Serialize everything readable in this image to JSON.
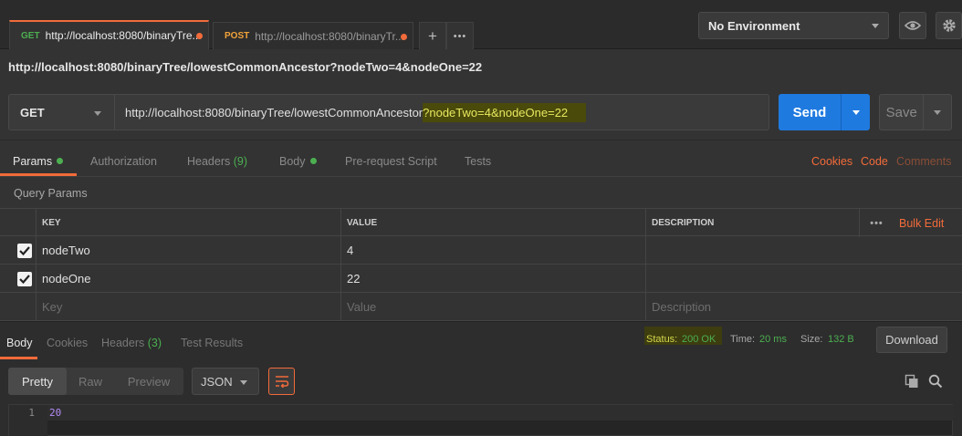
{
  "tabs": [
    {
      "method": "GET",
      "title": "http://localhost:8080/binaryTre...",
      "method_color": "#4caf50"
    },
    {
      "method": "POST",
      "title": "http://localhost:8080/binaryTr...",
      "method_color": "#f2a33a"
    }
  ],
  "tab_actions": {
    "add_icon": "plus-icon",
    "more_icon": "ellipsis-icon",
    "add_label": "+",
    "more_label": "•••"
  },
  "environment": {
    "selected": "No Environment"
  },
  "request": {
    "name": "http://localhost:8080/binaryTree/lowestCommonAncestor?nodeTwo=4&nodeOne=22",
    "method": "GET",
    "url_base": "http://localhost:8080/binaryTree/lowestCommonAncestor",
    "url_query": "?nodeTwo=4&nodeOne=22",
    "send_label": "Send",
    "save_label": "Save"
  },
  "request_tabs": {
    "params": "Params",
    "authorization": "Authorization",
    "headers": "Headers",
    "headers_count": "(9)",
    "body": "Body",
    "prerequest": "Pre-request Script",
    "tests": "Tests",
    "cookies": "Cookies",
    "code": "Code",
    "comments": "Comments"
  },
  "query_params": {
    "label": "Query Params",
    "columns": {
      "key": "KEY",
      "value": "VALUE",
      "description": "DESCRIPTION"
    },
    "more_label": "•••",
    "bulk_edit": "Bulk Edit",
    "rows": [
      {
        "key": "nodeTwo",
        "value": "4",
        "description": ""
      },
      {
        "key": "nodeOne",
        "value": "22",
        "description": ""
      }
    ],
    "placeholder": {
      "key": "Key",
      "value": "Value",
      "description": "Description"
    }
  },
  "response": {
    "tabs": {
      "body": "Body",
      "cookies": "Cookies",
      "headers": "Headers",
      "headers_count": "(3)",
      "test_results": "Test Results"
    },
    "status_label": "Status:",
    "status_value": "200 OK",
    "time_label": "Time:",
    "time_value": "20 ms",
    "size_label": "Size:",
    "size_value": "132 B",
    "download_label": "Download",
    "views": {
      "pretty": "Pretty",
      "raw": "Raw",
      "preview": "Preview"
    },
    "format": "JSON",
    "line_number": "1",
    "body_value": "20"
  },
  "colors": {
    "accent": "#f26b3a",
    "send": "#1f7ae0",
    "success": "#4caf50",
    "number": "#b58cf6"
  }
}
